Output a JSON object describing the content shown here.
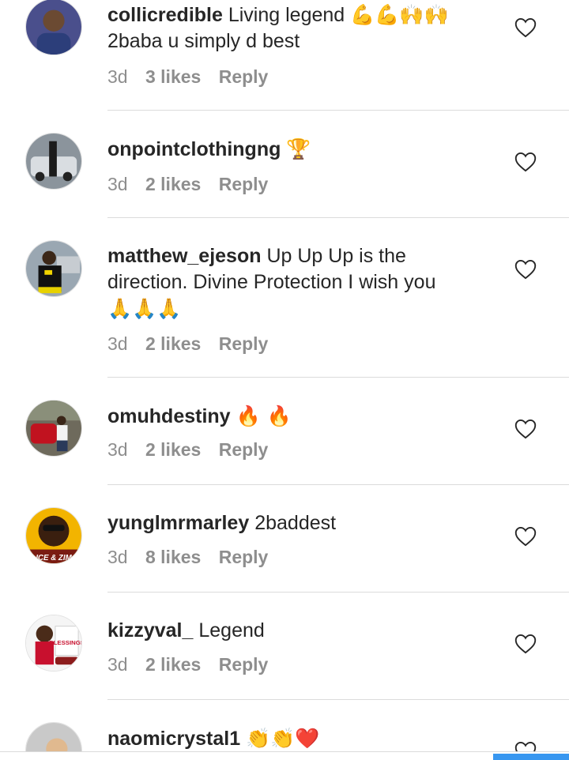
{
  "comments": [
    {
      "username": "collicredible",
      "text": "Living legend",
      "emoji": "💪💪🙌🙌",
      "text2": "2baba u simply d best",
      "time": "3d",
      "likes": "3 likes",
      "reply": "Reply"
    },
    {
      "username": "onpointclothingng",
      "text": "",
      "emoji": "🏆",
      "text2": "",
      "time": "3d",
      "likes": "2 likes",
      "reply": "Reply"
    },
    {
      "username": "matthew_ejeson",
      "text": "Up Up Up is the direction. Divine Protection I wish you",
      "emoji": "🙏🙏🙏",
      "text2": "",
      "time": "3d",
      "likes": "2 likes",
      "reply": "Reply"
    },
    {
      "username": "omuhdestiny",
      "text": "",
      "emoji": "🔥 🔥",
      "text2": "",
      "time": "3d",
      "likes": "2 likes",
      "reply": "Reply"
    },
    {
      "username": "yunglmrmarley",
      "text": "2baddest",
      "emoji": "",
      "text2": "",
      "time": "3d",
      "likes": "8 likes",
      "reply": "Reply"
    },
    {
      "username": "kizzyval_",
      "text": "Legend",
      "emoji": "",
      "text2": "",
      "time": "3d",
      "likes": "2 likes",
      "reply": "Reply"
    },
    {
      "username": "naomicrystal1",
      "text": "",
      "emoji": "👏👏❤️",
      "text2": "",
      "time": "",
      "likes": "",
      "reply": ""
    }
  ],
  "avatar_texts": {
    "yunglmrmarley": "ICE & ZIM",
    "kizzyval_": "BLESSINGS"
  },
  "colors": {
    "text": "#262626",
    "meta": "#8e8e8e",
    "divider": "#dbdbdb",
    "accent": "#3897f0"
  },
  "icons": [
    "heart-outline-icon"
  ]
}
